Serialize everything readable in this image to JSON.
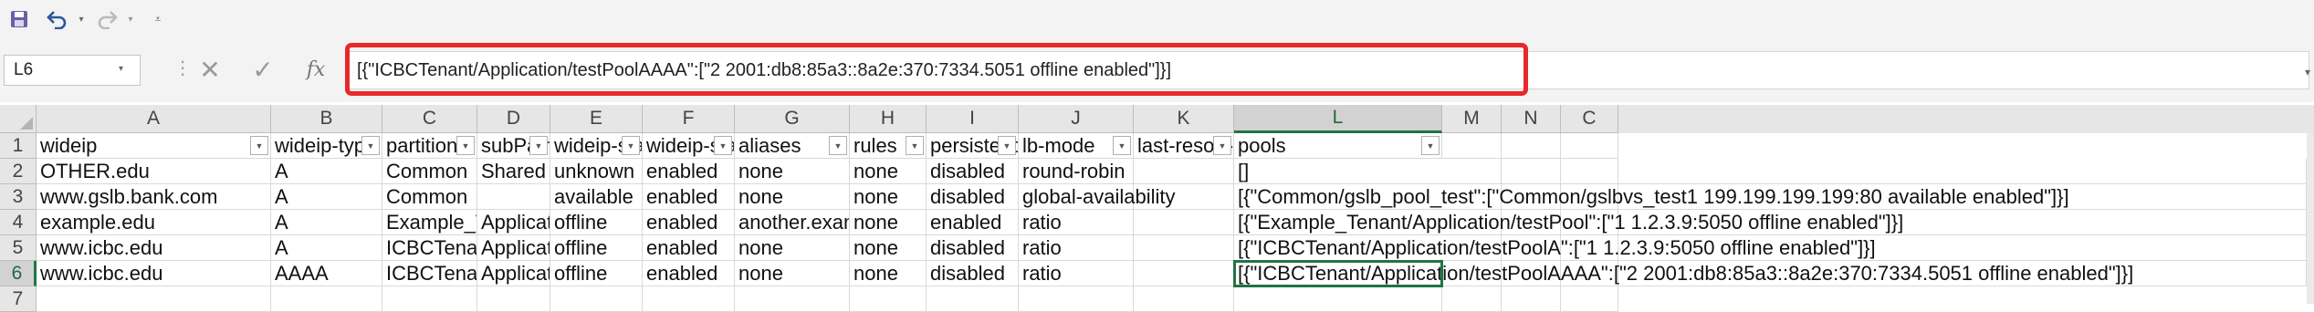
{
  "toolbar": {
    "save_icon": "save-icon",
    "undo_icon": "undo-icon",
    "redo_icon": "redo-icon",
    "more_icon": "customize-qat-icon"
  },
  "formula_bar": {
    "name_box": "L6",
    "cancel_glyph": "✕",
    "enter_glyph": "✓",
    "fx_glyph": "fx",
    "formula": "[{\"ICBCTenant/Application/testPoolAAAA\":[\"2 2001:db8:85a3::8a2e:370:7334.5051 offline enabled\"]}]"
  },
  "accent_color": "#217346",
  "highlight_color": "#e8282a",
  "columns": [
    "A",
    "B",
    "C",
    "D",
    "E",
    "F",
    "G",
    "H",
    "I",
    "J",
    "K",
    "L",
    "M",
    "N",
    "C"
  ],
  "rows": [
    "1",
    "2",
    "3",
    "4",
    "5",
    "6",
    "7"
  ],
  "headers": [
    "wideip",
    "wideip-type",
    "partition",
    "subPath",
    "wideip-status",
    "wideip-state",
    "aliases",
    "rules",
    "persistence",
    "lb-mode",
    "last-resort-pool",
    "pools"
  ],
  "data": [
    [
      "OTHER.edu",
      "A",
      "Common",
      "Shared",
      "unknown",
      "enabled",
      "none",
      "none",
      "disabled",
      "round-robin",
      "",
      "[]"
    ],
    [
      "www.gslb.bank.com",
      "A",
      "Common",
      "",
      "available",
      "enabled",
      "none",
      "none",
      "disabled",
      "global-availability",
      "",
      "[{\"Common/gslb_pool_test\":[\"Common/gslbvs_test1 199.199.199.199:80 available enabled\"]}]"
    ],
    [
      "example.edu",
      "A",
      "Example_Tenant",
      "Application",
      "offline",
      "enabled",
      "another.example*",
      "none",
      "enabled",
      "ratio",
      "",
      "[{\"Example_Tenant/Application/testPool\":[\"1 1.2.3.9:5050 offline enabled\"]}]"
    ],
    [
      "www.icbc.edu",
      "A",
      "ICBCTenant",
      "Application",
      "offline",
      "enabled",
      "none",
      "none",
      "disabled",
      "ratio",
      "",
      "[{\"ICBCTenant/Application/testPoolA\":[\"1 1.2.3.9:5050 offline enabled\"]}]"
    ],
    [
      "www.icbc.edu",
      "AAAA",
      "ICBCTenant",
      "Application",
      "offline",
      "enabled",
      "none",
      "none",
      "disabled",
      "ratio",
      "",
      "[{\"ICBCTenant/Application/testPoolAAAA\":[\"2 2001:db8:85a3::8a2e:370:7334.5051 offline enabled\"]}]"
    ]
  ]
}
